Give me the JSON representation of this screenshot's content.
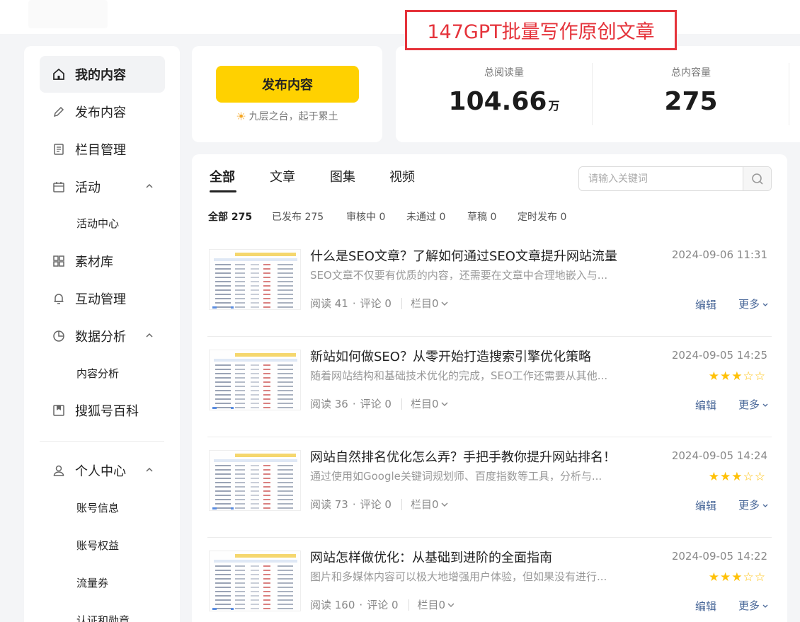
{
  "banner": "147GPT批量写作原创文章",
  "sidebar": {
    "items": [
      {
        "label": "我的内容",
        "icon": "home-icon"
      },
      {
        "label": "发布内容",
        "icon": "pencil-icon"
      },
      {
        "label": "栏目管理",
        "icon": "document-icon"
      },
      {
        "label": "活动",
        "icon": "calendar-icon"
      },
      {
        "label": "素材库",
        "icon": "grid-icon"
      },
      {
        "label": "互动管理",
        "icon": "bell-icon"
      },
      {
        "label": "数据分析",
        "icon": "pie-chart-icon"
      },
      {
        "label": "搜狐号百科",
        "icon": "bookmark-icon"
      },
      {
        "label": "个人中心",
        "icon": "user-icon"
      }
    ],
    "subs": {
      "activity_center": "活动中心",
      "content_analysis": "内容分析",
      "account_info": "账号信息",
      "account_rights": "账号权益",
      "traffic_coupon": "流量券",
      "certification": "认证和勋章"
    }
  },
  "publish": {
    "button_label": "发布内容",
    "motto": "九层之台，起于累土"
  },
  "stats": {
    "total_reads_label": "总阅读量",
    "total_reads_value": "104.66",
    "total_reads_unit": "万",
    "total_content_label": "总内容量",
    "total_content_value": "275"
  },
  "tabs": [
    "全部",
    "文章",
    "图集",
    "视频"
  ],
  "search": {
    "placeholder": "请输入关键词"
  },
  "filters": [
    "全部 275",
    "已发布 275",
    "审核中 0",
    "未通过 0",
    "草稿 0",
    "定时发布 0"
  ],
  "articles": [
    {
      "title": "什么是SEO文章？了解如何通过SEO文章提升网站流量",
      "summary": "SEO文章不仅要有优质的内容，还需要在文章中合理地嵌入与...",
      "date": "2024-09-06 11:31",
      "reads": "阅读  41",
      "comments": "评论  0",
      "column": "栏目0",
      "stars": null
    },
    {
      "title": "新站如何做SEO？从零开始打造搜索引擎优化策略",
      "summary": "随着网站结构和基础技术优化的完成，SEO工作还需要从其他...",
      "date": "2024-09-05 14:25",
      "reads": "阅读  36",
      "comments": "评论  0",
      "column": "栏目0",
      "stars": 3
    },
    {
      "title": "网站自然排名优化怎么弄？手把手教你提升网站排名！",
      "summary": "通过使用如Google关键词规划师、百度指数等工具，分析与...",
      "date": "2024-09-05 14:24",
      "reads": "阅读  73",
      "comments": "评论  0",
      "column": "栏目0",
      "stars": 3
    },
    {
      "title": "网站怎样做优化：从基础到进阶的全面指南",
      "summary": "图片和多媒体内容可以极大地增强用户体验，但如果没有进行...",
      "date": "2024-09-05 14:22",
      "reads": "阅读  160",
      "comments": "评论  0",
      "column": "栏目0",
      "stars": 3
    }
  ],
  "actions": {
    "edit": "编辑",
    "more": "更多"
  },
  "colors": {
    "accent": "#ffd100",
    "banner_red": "#e5333b",
    "link": "#4a6899",
    "star": "#ffc107"
  }
}
